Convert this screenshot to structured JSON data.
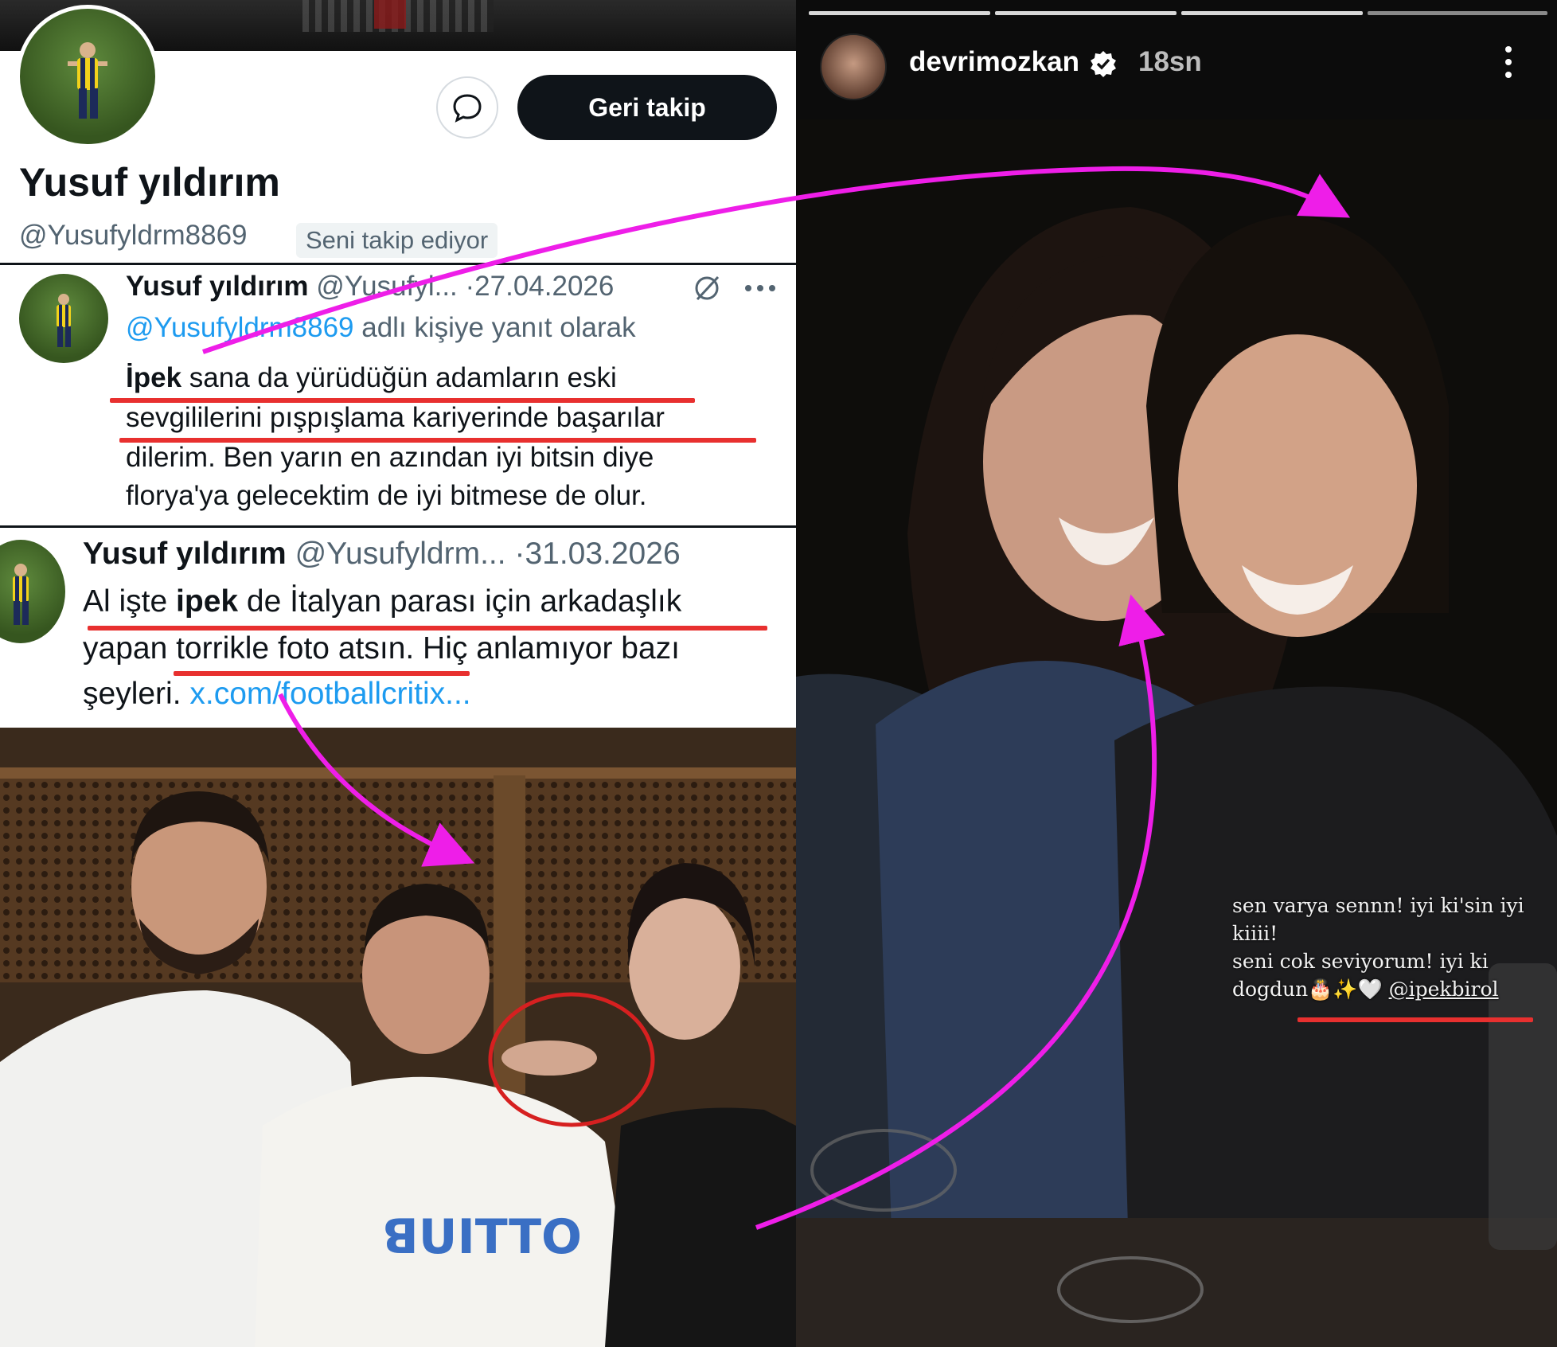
{
  "profile": {
    "name": "Yusuf yıldırım",
    "handle": "@Yusufyldrm8869",
    "follows_you": "Seni takip ediyor",
    "follow_back_label": "Geri takip",
    "message_icon": "message-bubble-icon"
  },
  "tweets": [
    {
      "author": "Yusuf yıldırım",
      "handle": "@Yusufyl...",
      "date": "27.04.2026",
      "reply_to_handle": "@Yusufyldrm8869",
      "reply_to_suffix": " adlı kişiye yanıt olarak",
      "lines": [
        {
          "bold": "İpek",
          "text": " sana da yürüdüğün adamların eski"
        },
        {
          "bold": "",
          "text": "sevgililerini pışpışlama kariyerinde başarılar"
        },
        {
          "bold": "",
          "text": "dilerim. Ben yarın en azından iyi bitsin diye"
        },
        {
          "bold": "",
          "text": "florya'ya gelecektim de iyi bitmese de olur."
        }
      ]
    },
    {
      "author": "Yusuf yıldırım",
      "handle": "@Yusufyldrm...",
      "date": "31.03.2026",
      "line1_a": "Al işte ",
      "line1_bold": "ipek",
      "line1_b": " de İtalyan parası için arkadaşlık",
      "line2": "yapan torrikle foto atsın. Hiç anlamıyor bazı",
      "line3_text": "şeyleri. ",
      "line3_link": "x.com/footballcritix..."
    }
  ],
  "story": {
    "username": "devrimozkan",
    "time": "18sn",
    "caption_lines": [
      "sen varya sennn! iyi ki'sin iyi",
      "kiiii!",
      "seni cok seviyorum! iyi ki"
    ],
    "caption_last": "dogdun🎂✨🤍 ",
    "caption_mention": "@ipekbirol"
  },
  "colors": {
    "annotation_magenta": "#ee1ee8",
    "underline_red": "#e8302f",
    "link_blue": "#1d9bf0",
    "button_dark": "#0f1419"
  }
}
